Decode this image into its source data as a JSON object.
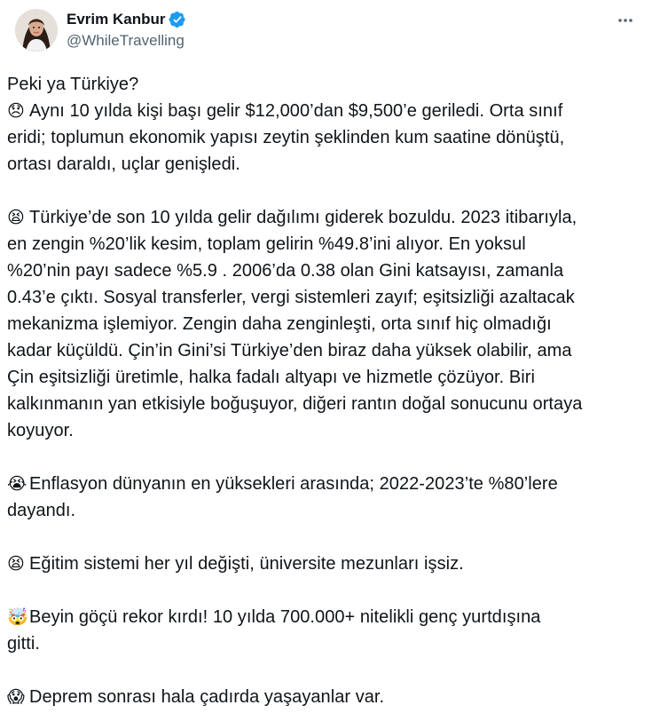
{
  "author": {
    "display_name": "Evrim Kanbur",
    "handle": "@WhileTravelling",
    "verified": true,
    "verified_color": "#1d9bf0"
  },
  "icons": {
    "verified": "verified-badge-icon",
    "more": "more-options-icon",
    "disappointed": "disappointed-face-icon",
    "tired": "tired-face-icon",
    "crying": "crying-face-icon",
    "exploding": "exploding-head-icon",
    "scream": "screaming-face-icon"
  },
  "text": {
    "l1": "Peki ya Türkiye?",
    "p1": [
      "Aynı 10 yılda kişi başı gelir $12,000’dan $9,500’e geriledi. Orta sınıf",
      "eridi; toplumun ekonomik yapısı zeytin şeklinden kum saatine dönüştü,",
      "ortası daraldı, uçlar genişledi."
    ],
    "p2": [
      "Türkiye’de son 10 yılda gelir dağılımı giderek bozuldu. 2023 itibarıyla,",
      "en zengin %20’lik kesim, toplam gelirin %49.8’ini alıyor. En yoksul",
      "%20’nin payı sadece %5.9 . 2006’da 0.38 olan Gini katsayısı, zamanla",
      "0.43’e çıktı. Sosyal transferler, vergi sistemleri zayıf; eşitsizliği azaltacak",
      "mekanizma işlemiyor. Zengin daha zenginleşti, orta sınıf hiç olmadığı",
      "kadar küçüldü. Çin’in Gini’si Türkiye’den biraz daha yüksek olabilir, ama",
      "Çin eşitsizliği üretimle, halka fadalı altyapı ve hizmetle çözüyor. Biri",
      "kalkınmanın yan etkisiyle boğuşuyor, diğeri rantın doğal sonucunu ortaya",
      "koyuyor."
    ],
    "p3": [
      "Enflasyon dünyanın en yüksekleri arasında; 2022-2023’te %80’lere",
      "dayandı."
    ],
    "p4": "Eğitim sistemi her yıl değişti, üniversite mezunları işsiz.",
    "p5": [
      "Beyin göçü rekor kırdı! 10 yılda 700.000+ nitelikli genç yurtdışına",
      "gitti."
    ],
    "p6": "Deprem sonrası hala çadırda yaşayanlar var."
  }
}
